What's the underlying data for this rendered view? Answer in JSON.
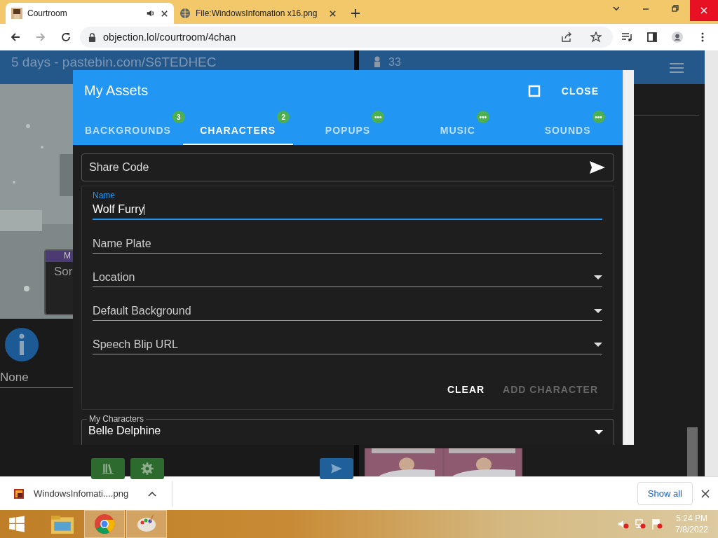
{
  "browser": {
    "tabs": [
      {
        "title": "Courtroom",
        "selected": true,
        "audio": true
      },
      {
        "title": "File:WindowsInfomation x16.png",
        "selected": false,
        "audio": false
      }
    ],
    "url": "objection.lol/courtroom/4chan"
  },
  "page": {
    "left_header": "5 days - pastebin.com/S6TEDHEC",
    "right_header": "33",
    "nameplate_top": "M",
    "nameplate_text": "Sor",
    "dropdown_value": "None"
  },
  "dialog": {
    "title": "My Assets",
    "close": "CLOSE",
    "tabs": [
      {
        "label": "BACKGROUNDS",
        "badge": "3",
        "selected": false
      },
      {
        "label": "CHARACTERS",
        "badge": "2",
        "selected": true
      },
      {
        "label": "POPUPS",
        "badge": "•••",
        "selected": false
      },
      {
        "label": "MUSIC",
        "badge": "•••",
        "selected": false
      },
      {
        "label": "SOUNDS",
        "badge": "•••",
        "selected": false
      }
    ],
    "share_code": {
      "placeholder": "Share Code"
    },
    "fields": [
      {
        "label": "Name",
        "value": "Wolf Furry",
        "kind": "text",
        "focused": true
      },
      {
        "label": "Name Plate",
        "kind": "text",
        "focused": false
      },
      {
        "label": "Location",
        "kind": "select",
        "focused": false
      },
      {
        "label": "Default Background",
        "kind": "select",
        "focused": false
      },
      {
        "label": "Speech Blip URL",
        "kind": "select",
        "focused": false
      }
    ],
    "actions": [
      {
        "label": "CLEAR",
        "disabled": false
      },
      {
        "label": "ADD CHARACTER",
        "disabled": true
      }
    ],
    "my_characters": {
      "label": "My Characters",
      "value": "Belle Delphine"
    }
  },
  "downloads": {
    "file": "WindowsInfomati....png",
    "show_all": "Show all"
  },
  "taskbar": {
    "time": "5:24 PM",
    "date": "7/8/2022"
  }
}
